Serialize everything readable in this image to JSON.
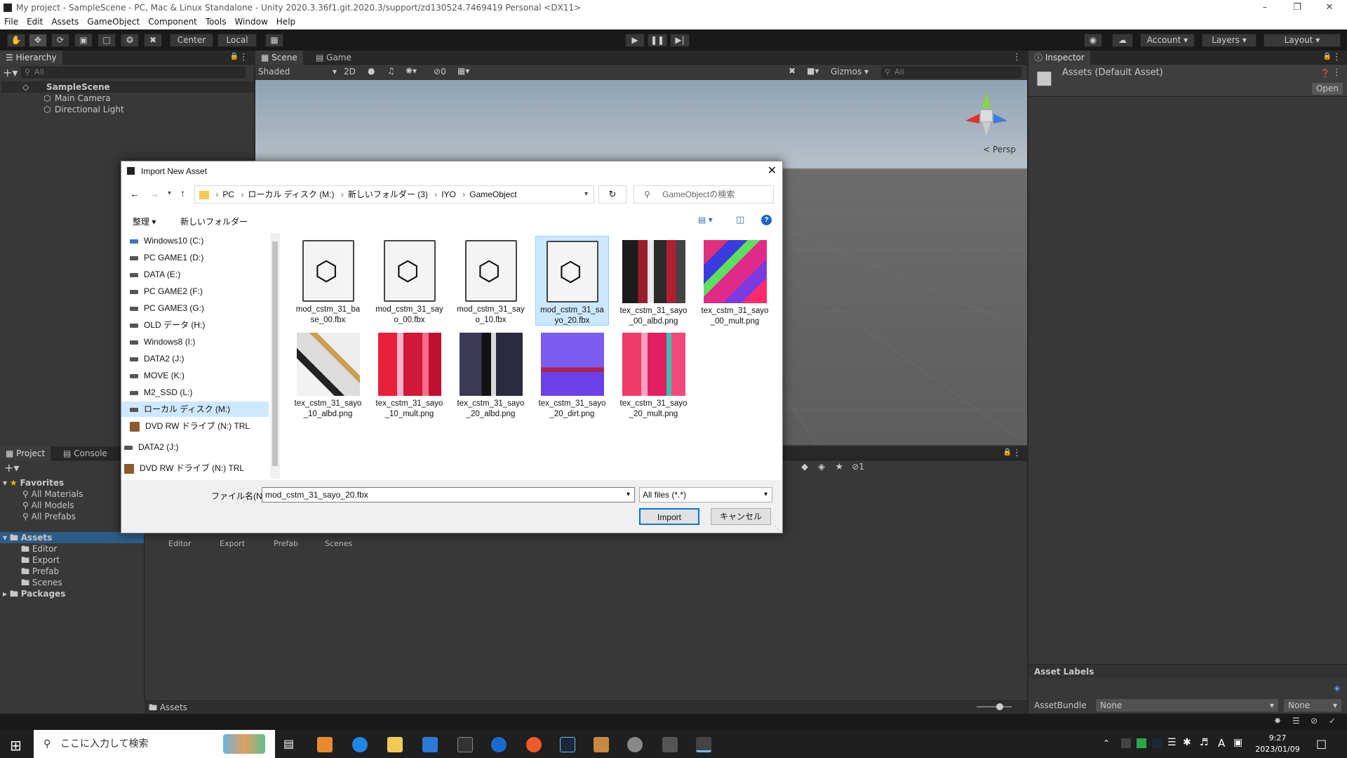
{
  "window": {
    "title": "My project - SampleScene - PC, Mac & Linux Standalone - Unity 2020.3.36f1.git.2020.3/support/zd130524.7469419 Personal <DX11>"
  },
  "menu": [
    "File",
    "Edit",
    "Assets",
    "GameObject",
    "Component",
    "Tools",
    "Window",
    "Help"
  ],
  "toolbar": {
    "pivot": "Center",
    "space": "Local",
    "account": "Account",
    "layers": "Layers",
    "layout": "Layout"
  },
  "hierarchy": {
    "tab": "Hierarchy",
    "search": "All",
    "scene": "SampleScene",
    "items": [
      "Main Camera",
      "Directional Light"
    ]
  },
  "scene": {
    "tabs": [
      "Scene",
      "Game"
    ],
    "shading": "Shaded",
    "mode2d": "2D",
    "hidden_count": "0",
    "gizmos": "Gizmos",
    "search": "All",
    "persp": "< Persp"
  },
  "inspector": {
    "tab": "Inspector",
    "asset": "Assets (Default Asset)",
    "open": "Open",
    "labels": "Asset Labels",
    "bundle_label": "AssetBundle",
    "bundle_value": "None",
    "variant_value": "None"
  },
  "project": {
    "tabs": [
      "Project",
      "Console"
    ],
    "favorites": "Favorites",
    "fav_items": [
      "All Materials",
      "All Models",
      "All Prefabs"
    ],
    "assets": "Assets",
    "asset_items": [
      "Editor",
      "Export",
      "Prefab",
      "Scenes"
    ],
    "packages": "Packages",
    "grid_items": [
      "Editor",
      "Export",
      "Prefab",
      "Scenes"
    ],
    "footer": "Assets",
    "badge": "1"
  },
  "dialog": {
    "title": "Import New Asset",
    "breadcrumb": [
      "PC",
      "ローカル ディスク (M:)",
      "新しいフォルダー (3)",
      "IYO",
      "GameObject"
    ],
    "search_placeholder": "GameObjectの検索",
    "organize": "整理",
    "new_folder": "新しいフォルダー",
    "nav": [
      "Windows10 (C:)",
      "PC GAME1 (D:)",
      "DATA (E:)",
      "PC GAME2 (F:)",
      "PC GAME3 (G:)",
      "OLD データ (H:)",
      "Windows8 (I:)",
      "DATA2 (J:)",
      "MOVE (K:)",
      "M2_SSD (L:)",
      "ローカル ディスク (M:)",
      "DVD RW ドライブ (N:) TRL",
      "DATA2 (J:)",
      "DVD RW ドライブ (N:) TRL"
    ],
    "files": [
      {
        "name": "mod_cstm_31_base_00.fbx",
        "kind": "fbx"
      },
      {
        "name": "mod_cstm_31_sayo_00.fbx",
        "kind": "fbx"
      },
      {
        "name": "mod_cstm_31_sayo_10.fbx",
        "kind": "fbx"
      },
      {
        "name": "mod_cstm_31_sayo_20.fbx",
        "kind": "fbx"
      },
      {
        "name": "tex_cstm_31_sayo_00_albd.png",
        "kind": "png"
      },
      {
        "name": "tex_cstm_31_sayo_00_mult.png",
        "kind": "png"
      },
      {
        "name": "tex_cstm_31_sayo_10_albd.png",
        "kind": "png"
      },
      {
        "name": "tex_cstm_31_sayo_10_mult.png",
        "kind": "png"
      },
      {
        "name": "tex_cstm_31_sayo_20_albd.png",
        "kind": "png"
      },
      {
        "name": "tex_cstm_31_sayo_20_dirt.png",
        "kind": "png"
      },
      {
        "name": "tex_cstm_31_sayo_20_mult.png",
        "kind": "png"
      }
    ],
    "selected_file": "mod_cstm_31_sayo_20.fbx",
    "filename_label": "ファイル名(N):",
    "filename_value": "mod_cstm_31_sayo_20.fbx",
    "filter": "All files (*.*)",
    "import": "Import",
    "cancel": "キャンセル"
  },
  "taskbar": {
    "search_placeholder": "ここに入力して検索",
    "time": "9:27",
    "date": "2023/01/09",
    "ime": "A"
  }
}
